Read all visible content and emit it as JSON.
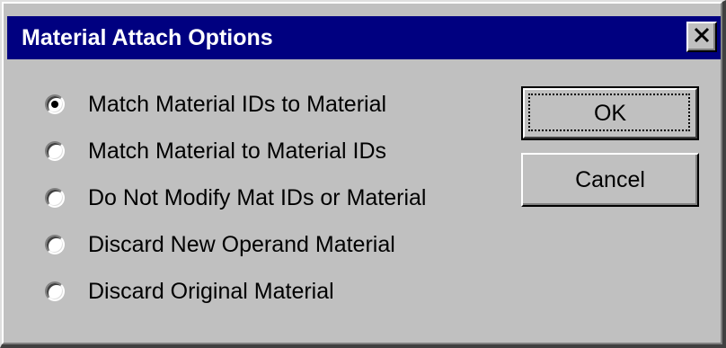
{
  "window": {
    "title": "Material Attach Options",
    "close_icon": "close-icon"
  },
  "options": [
    {
      "label": "Match Material IDs to Material",
      "selected": true
    },
    {
      "label": "Match Material to Material IDs",
      "selected": false
    },
    {
      "label": "Do Not Modify Mat IDs or Material",
      "selected": false
    },
    {
      "label": "Discard New Operand Material",
      "selected": false
    },
    {
      "label": "Discard Original Material",
      "selected": false
    }
  ],
  "buttons": {
    "ok_label": "OK",
    "cancel_label": "Cancel"
  },
  "colors": {
    "title_bar": "#000080",
    "dialog_face": "#c0c0c0",
    "title_text": "#ffffff"
  }
}
